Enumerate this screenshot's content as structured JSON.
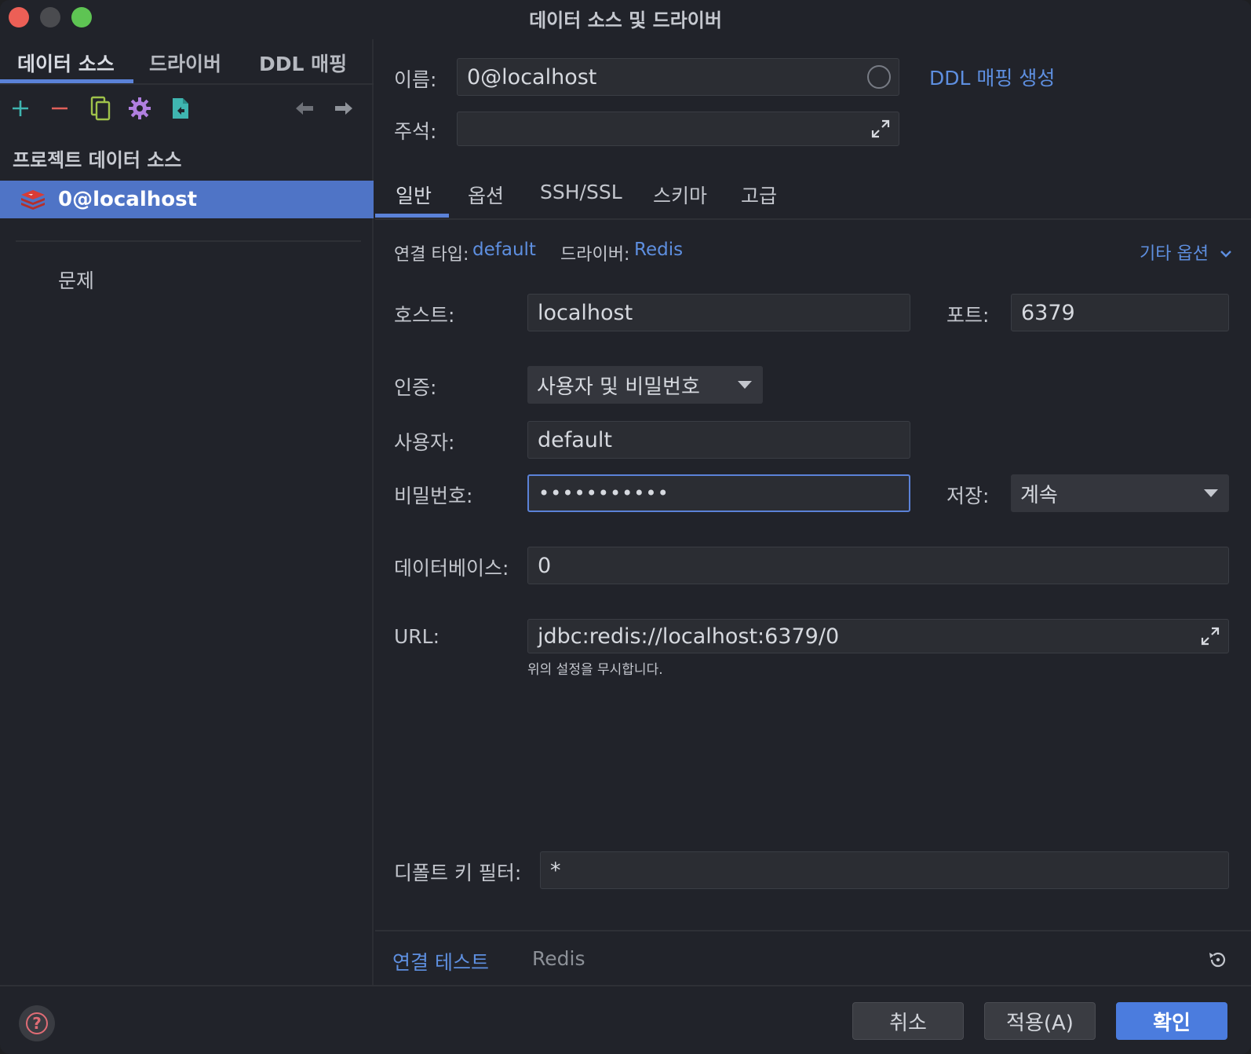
{
  "window": {
    "title": "데이터 소스 및 드라이버"
  },
  "left": {
    "tabs": [
      {
        "label": "데이터 소스"
      },
      {
        "label": "드라이버"
      },
      {
        "label": "DDL 매핑"
      }
    ],
    "section_title": "프로젝트 데이터 소스",
    "datasource": {
      "label": "0@localhost"
    },
    "problems_label": "문제",
    "toolbar_icons": [
      "add-icon",
      "remove-icon",
      "copy-icon",
      "settings-icon",
      "import-icon",
      "back-arrow-icon",
      "forward-arrow-icon"
    ]
  },
  "form": {
    "name_label": "이름:",
    "name_value": "0@localhost",
    "ddl_link": "DDL 매핑 생성",
    "comment_label": "주석:",
    "comment_value": "",
    "tabs": [
      {
        "label": "일반"
      },
      {
        "label": "옵션"
      },
      {
        "label": "SSH/SSL"
      },
      {
        "label": "스키마"
      },
      {
        "label": "고급"
      }
    ],
    "conn_type_label": "연결 타입:",
    "conn_type_value": "default",
    "driver_label": "드라이버:",
    "driver_value": "Redis",
    "more_options": "기타 옵션",
    "host_label": "호스트:",
    "host_value": "localhost",
    "port_label": "포트:",
    "port_value": "6379",
    "auth_label": "인증:",
    "auth_value": "사용자 및 비밀번호",
    "user_label": "사용자:",
    "user_value": "default",
    "password_label": "비밀번호:",
    "password_value": "•••••••••••",
    "save_label": "저장:",
    "save_value": "계속",
    "database_label": "데이터베이스:",
    "database_value": "0",
    "url_label": "URL:",
    "url_value": "jdbc:redis://localhost:6379/0",
    "url_hint": "위의 설정을 무시합니다.",
    "key_filter_label": "디폴트 키 필터:",
    "key_filter_value": "*",
    "test_connection": "연결 테스트",
    "driver_footer": "Redis"
  },
  "buttons": {
    "cancel": "취소",
    "apply": "적용(A)",
    "ok": "확인",
    "help": "?"
  },
  "colors": {
    "accent": "#5b82d8",
    "link": "#5e8fe0",
    "selection": "#4f74c6",
    "close": "#ec5f56",
    "maximize": "#5ec453"
  }
}
